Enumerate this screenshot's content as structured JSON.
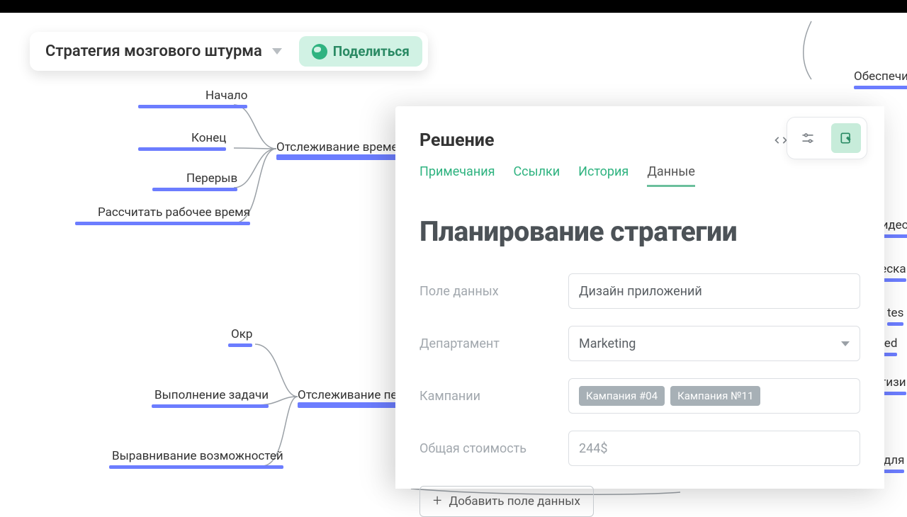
{
  "header": {
    "title": "Стратегия мозгового штурма",
    "share_label": "Поделиться"
  },
  "mindmap": {
    "nodes": {
      "n1": "Начало",
      "n2": "Конец",
      "n3": "Перерыв",
      "n4": "Рассчитать рабочее время",
      "n5": "Отслеживание времени",
      "n6": "Окр",
      "n7": "Выполнение задачи",
      "n8": "Выравнивание возможностей",
      "n9": "Отслеживание пери",
      "r1": "Обеспечит",
      "r2": "Видео",
      "r3": "ческа",
      "r4": "tes",
      "r5": "ated",
      "r6": "атизи",
      "r7": "и для"
    }
  },
  "panel": {
    "title": "Решение",
    "tabs": [
      "Примечания",
      "Ссылки",
      "История",
      "Данные"
    ],
    "active_tab_index": 3,
    "content_title": "Планирование стратегии",
    "fields": {
      "data_field": {
        "label": "Поле данных",
        "value": "Дизайн приложений"
      },
      "department": {
        "label": "Департамент",
        "value": "Marketing"
      },
      "campaigns": {
        "label": "Кампании",
        "tags": [
          "Кампания #04",
          "Кампания №11"
        ]
      },
      "total_cost": {
        "label": "Общая стоимость",
        "value": "244$"
      }
    },
    "add_field_label": "Добавить поле данных"
  }
}
